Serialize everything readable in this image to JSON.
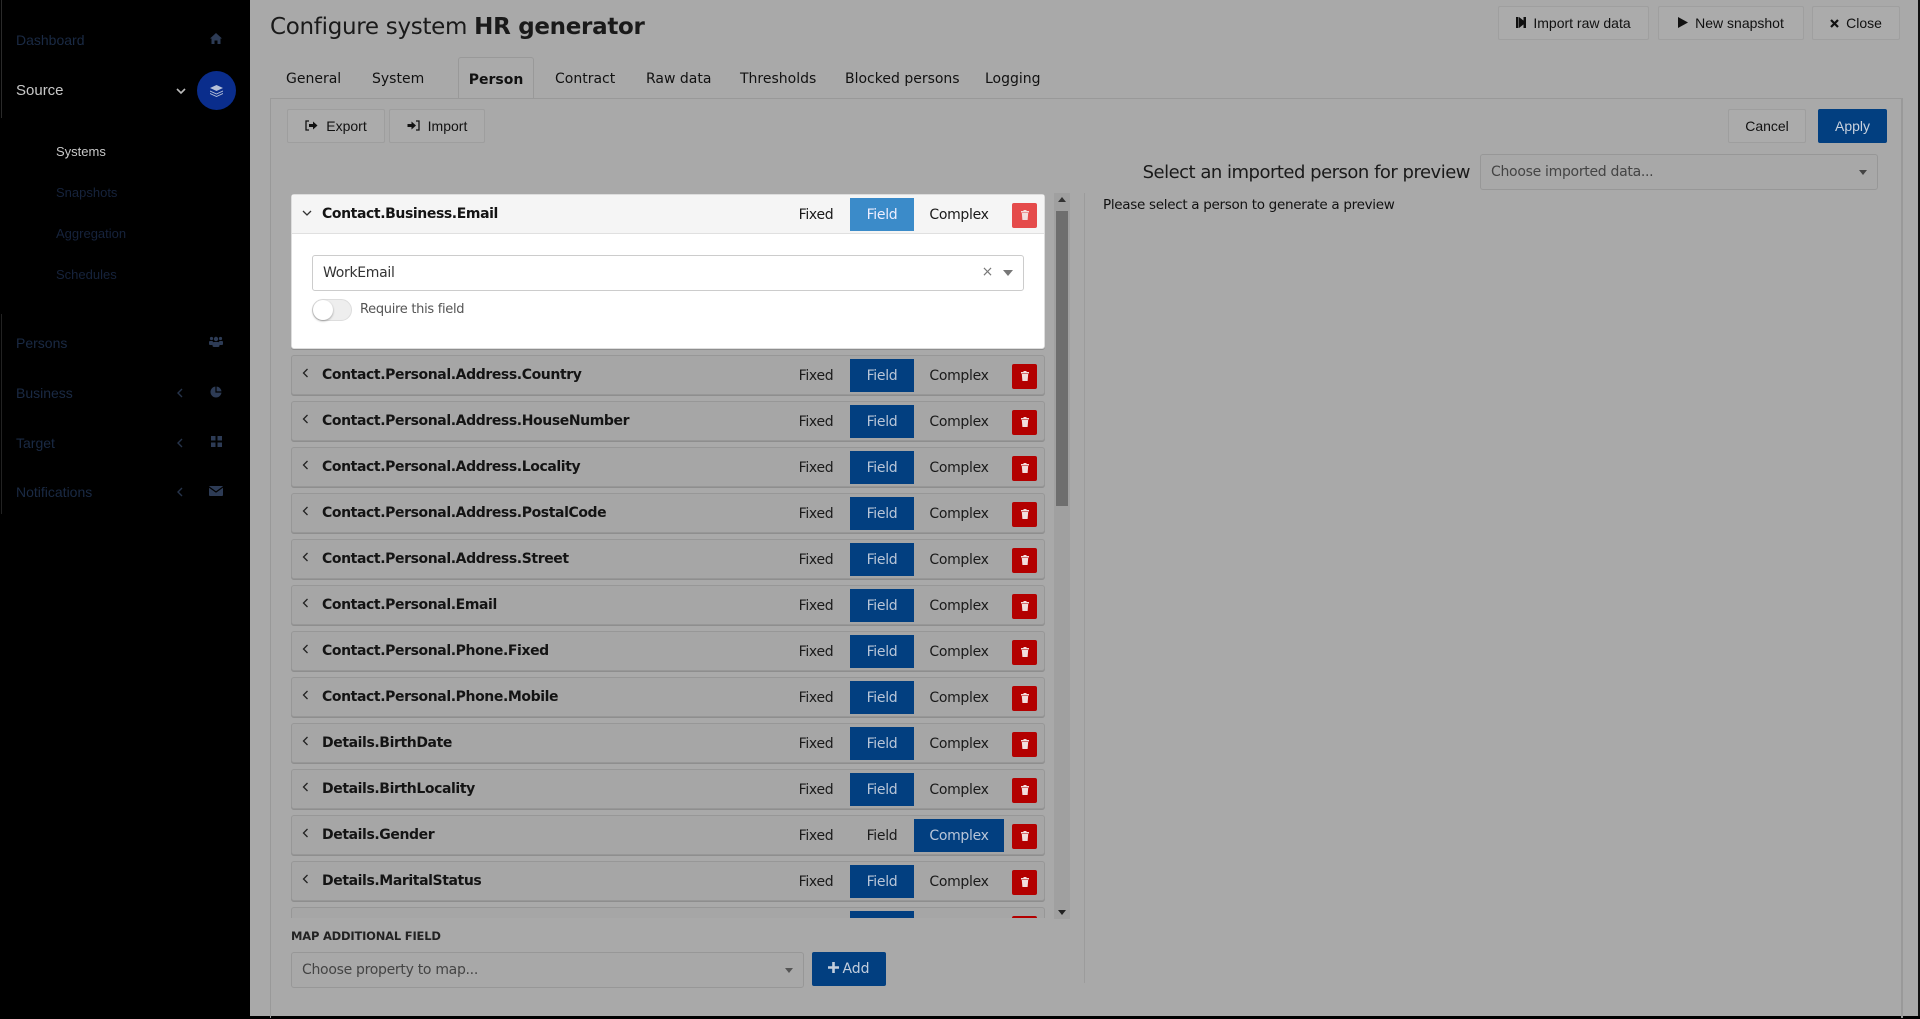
{
  "sidebar": {
    "items": [
      {
        "label": "Dashboard",
        "icon": "home-icon"
      },
      {
        "label": "Source",
        "icon": "layers-icon",
        "active": true,
        "expanded": true
      },
      {
        "label": "Persons",
        "icon": "users-icon"
      },
      {
        "label": "Business",
        "icon": "pie-chart-icon"
      },
      {
        "label": "Target",
        "icon": "grid-icon"
      },
      {
        "label": "Notifications",
        "icon": "envelope-icon"
      }
    ],
    "sub_items": [
      {
        "label": "Systems",
        "active": true
      },
      {
        "label": "Snapshots"
      },
      {
        "label": "Aggregation"
      },
      {
        "label": "Schedules"
      }
    ]
  },
  "header": {
    "title_prefix": "Configure system",
    "title_name": "HR generator",
    "buttons": {
      "import_raw": "Import raw data",
      "new_snapshot": "New snapshot",
      "close": "Close"
    }
  },
  "tabs": [
    {
      "label": "General"
    },
    {
      "label": "System"
    },
    {
      "label": "Person",
      "active": true
    },
    {
      "label": "Contract"
    },
    {
      "label": "Raw data"
    },
    {
      "label": "Thresholds"
    },
    {
      "label": "Blocked persons"
    },
    {
      "label": "Logging"
    }
  ],
  "toolbar": {
    "export": "Export",
    "import": "Import",
    "cancel": "Cancel",
    "apply": "Apply"
  },
  "mapping_modes": {
    "fixed": "Fixed",
    "field": "Field",
    "complex": "Complex"
  },
  "mappings": [
    {
      "name": "Contact.Business.Email",
      "mode": "field",
      "expanded": true,
      "value": "WorkEmail",
      "require_label": "Require this field",
      "required": false
    },
    {
      "name": "Contact.Personal.Address.Country",
      "mode": "field"
    },
    {
      "name": "Contact.Personal.Address.HouseNumber",
      "mode": "field"
    },
    {
      "name": "Contact.Personal.Address.Locality",
      "mode": "field"
    },
    {
      "name": "Contact.Personal.Address.PostalCode",
      "mode": "field"
    },
    {
      "name": "Contact.Personal.Address.Street",
      "mode": "field"
    },
    {
      "name": "Contact.Personal.Email",
      "mode": "field"
    },
    {
      "name": "Contact.Personal.Phone.Fixed",
      "mode": "field"
    },
    {
      "name": "Contact.Personal.Phone.Mobile",
      "mode": "field"
    },
    {
      "name": "Details.BirthDate",
      "mode": "field"
    },
    {
      "name": "Details.BirthLocality",
      "mode": "field"
    },
    {
      "name": "Details.Gender",
      "mode": "complex"
    },
    {
      "name": "Details.MaritalStatus",
      "mode": "field"
    },
    {
      "name": "",
      "mode": "field"
    }
  ],
  "map_additional": {
    "label": "MAP ADDITIONAL FIELD",
    "placeholder": "Choose property to map...",
    "add_label": "Add"
  },
  "preview": {
    "label": "Select an imported person for preview",
    "placeholder": "Choose imported data...",
    "message": "Please select a person to generate a preview"
  },
  "colors": {
    "primary": "#023f80",
    "field_active_light": "#3b8bc9",
    "danger": "#b30000",
    "sidebar_active": "#0a2d8c"
  }
}
